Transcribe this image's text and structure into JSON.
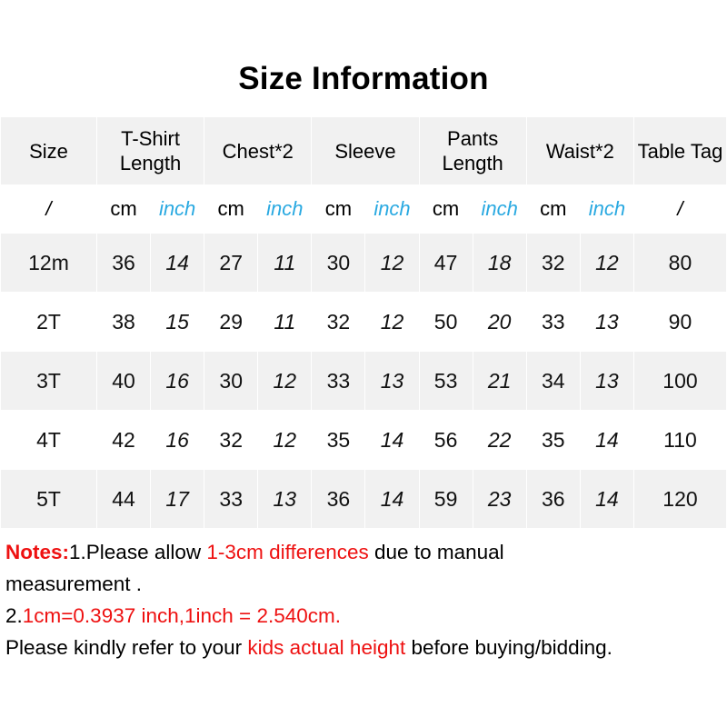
{
  "title": "Size Information",
  "table": {
    "headers": [
      "Size",
      "T-Shirt Length",
      "Chest*2",
      "Sleeve",
      "Pants Length",
      "Waist*2",
      "Table Tag"
    ],
    "units": [
      "/",
      "cm",
      "inch",
      "cm",
      "inch",
      "cm",
      "inch",
      "cm",
      "inch",
      "cm",
      "inch",
      "/"
    ],
    "rows": [
      {
        "size": "12m",
        "shirt_cm": "36",
        "shirt_in": "14",
        "chest_cm": "27",
        "chest_in": "11",
        "sleeve_cm": "30",
        "sleeve_in": "12",
        "pants_cm": "47",
        "pants_in": "18",
        "waist_cm": "32",
        "waist_in": "12",
        "tag": "80"
      },
      {
        "size": "2T",
        "shirt_cm": "38",
        "shirt_in": "15",
        "chest_cm": "29",
        "chest_in": "11",
        "sleeve_cm": "32",
        "sleeve_in": "12",
        "pants_cm": "50",
        "pants_in": "20",
        "waist_cm": "33",
        "waist_in": "13",
        "tag": "90"
      },
      {
        "size": "3T",
        "shirt_cm": "40",
        "shirt_in": "16",
        "chest_cm": "30",
        "chest_in": "12",
        "sleeve_cm": "33",
        "sleeve_in": "13",
        "pants_cm": "53",
        "pants_in": "21",
        "waist_cm": "34",
        "waist_in": "13",
        "tag": "100"
      },
      {
        "size": "4T",
        "shirt_cm": "42",
        "shirt_in": "16",
        "chest_cm": "32",
        "chest_in": "12",
        "sleeve_cm": "35",
        "sleeve_in": "14",
        "pants_cm": "56",
        "pants_in": "22",
        "waist_cm": "35",
        "waist_in": "14",
        "tag": "110"
      },
      {
        "size": "5T",
        "shirt_cm": "44",
        "shirt_in": "17",
        "chest_cm": "33",
        "chest_in": "13",
        "sleeve_cm": "36",
        "sleeve_in": "14",
        "pants_cm": "59",
        "pants_in": "23",
        "waist_cm": "36",
        "waist_in": "14",
        "tag": "120"
      }
    ]
  },
  "notes": {
    "label": "Notes:",
    "line1_a": "1.Please allow ",
    "line1_red": "1-3cm differences",
    "line1_b": " due to manual",
    "line2": "measurement .",
    "line3_a": "2.",
    "line3_red": "1cm=0.3937 inch,1inch = 2.540cm.",
    "line4_a": "Please kindly refer to your ",
    "line4_red": "kids actual height",
    "line4_b": " before buying/bidding."
  },
  "colors": {
    "inch_blue": "#29a9e1",
    "note_red": "#ee1111",
    "row_shade": "#f1f1f1"
  }
}
